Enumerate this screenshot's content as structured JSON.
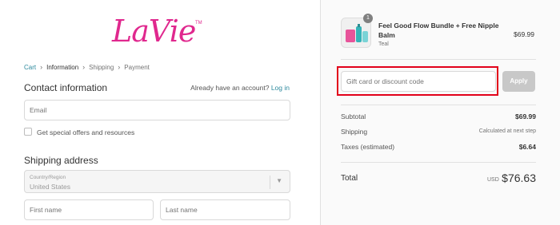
{
  "brand": {
    "logo_text": "LaVie",
    "tm": "TM"
  },
  "breadcrumb": {
    "items": [
      "Cart",
      "Information",
      "Shipping",
      "Payment"
    ],
    "separator": "›"
  },
  "contact": {
    "title": "Contact information",
    "have_account": "Already have an account?",
    "login_link": "Log in",
    "email_placeholder": "Email",
    "offers_label": "Get special offers and resources"
  },
  "shipping": {
    "title": "Shipping address",
    "country_label": "Country/Region",
    "country_value": "United States",
    "first_name_placeholder": "First name",
    "last_name_placeholder": "Last name"
  },
  "order": {
    "quantity": "1",
    "product_name": "Feel Good Flow Bundle + Free Nipple Balm",
    "variant": "Teal",
    "price": "$69.99",
    "discount_placeholder": "Gift card or discount code",
    "apply_label": "Apply",
    "subtotal_label": "Subtotal",
    "subtotal_value": "$69.99",
    "shipping_label": "Shipping",
    "shipping_value": "Calculated at next step",
    "taxes_label": "Taxes (estimated)",
    "taxes_value": "$6.64",
    "total_label": "Total",
    "total_currency": "USD",
    "total_value": "$76.63"
  },
  "colors": {
    "brand_pink": "#e0288e",
    "link_teal": "#2e8a9e",
    "highlight_red": "#e2001a",
    "apply_gray": "#c8c8c8"
  }
}
